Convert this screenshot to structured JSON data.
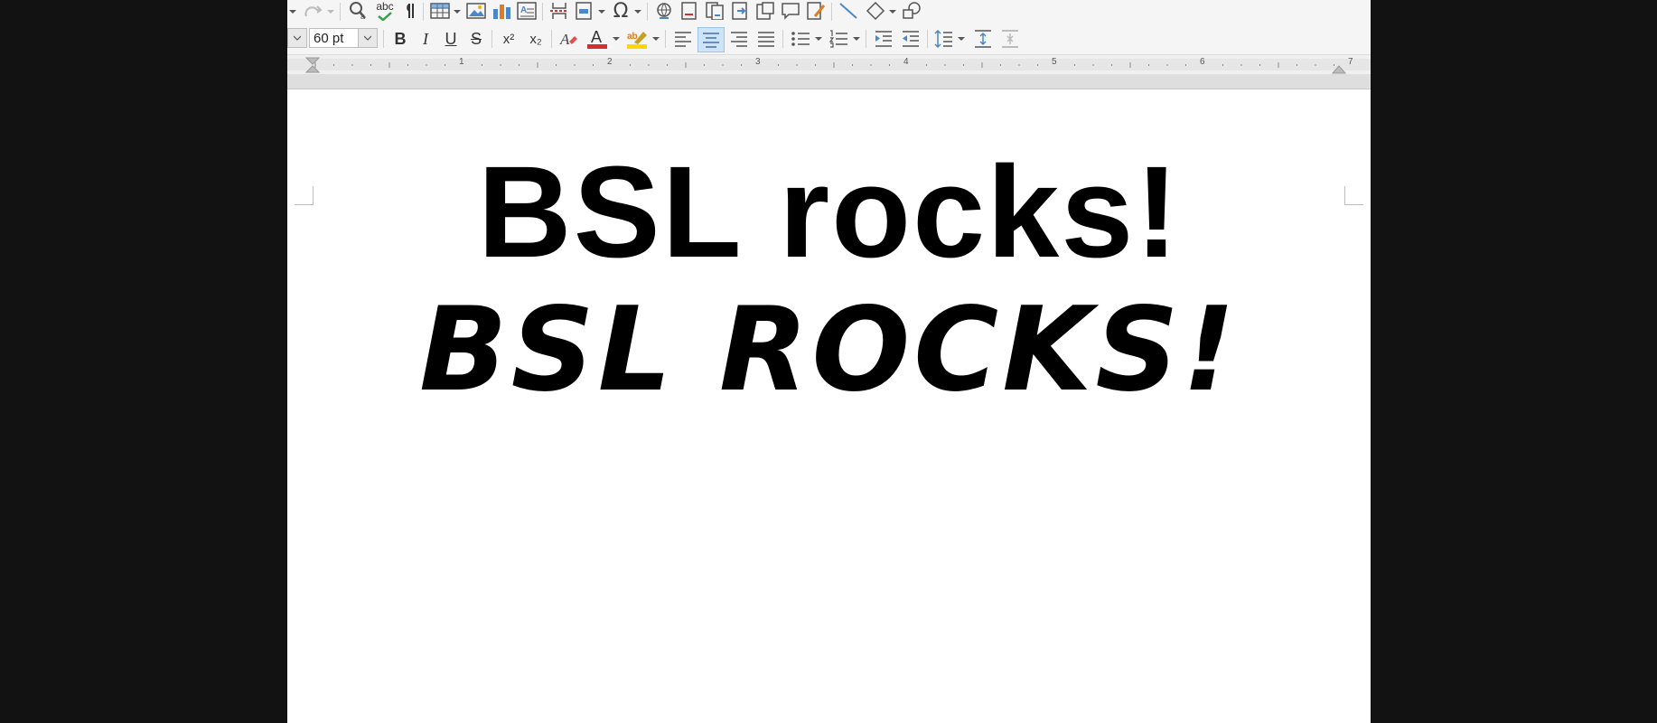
{
  "toolbar": {
    "spelling_label": "abc",
    "font_size_value": "60 pt"
  },
  "format": {
    "bold": "B",
    "italic": "I",
    "underline": "U",
    "strikethrough": "S",
    "superscript": "x²",
    "subscript": "x₂"
  },
  "ruler": {
    "numbers": [
      "1",
      "2",
      "3",
      "4",
      "5",
      "6",
      "7"
    ]
  },
  "document": {
    "line1": "BSL rocks!",
    "line2": "BSL ROCKS!"
  },
  "colors": {
    "font_color_accent": "#d32f2f",
    "highlight_accent": "#ffd600",
    "selected_button_bg": "#cde3f7"
  }
}
